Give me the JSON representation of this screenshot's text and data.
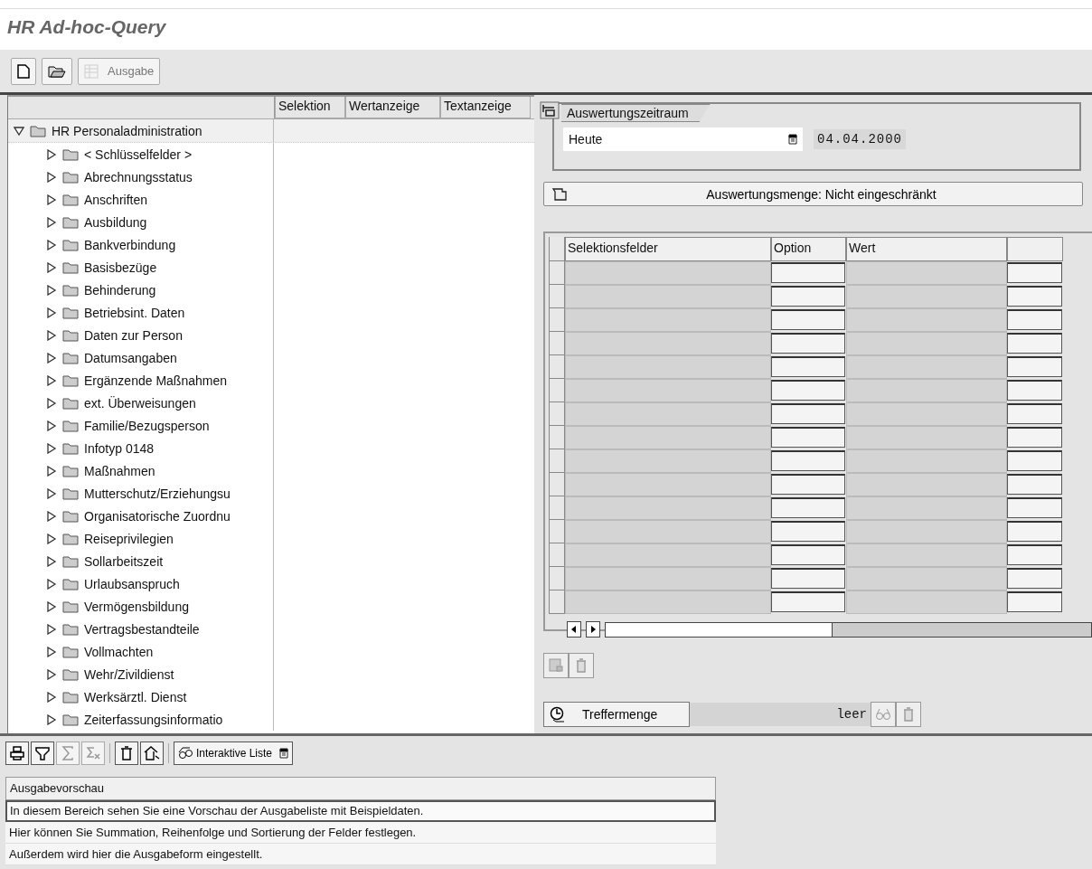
{
  "window": {
    "title": "HR Ad-hoc-Query"
  },
  "toolbar": [
    {
      "kind": "new",
      "disabled": false
    },
    {
      "kind": "open",
      "disabled": false
    },
    {
      "kind": "output",
      "label": "Ausgabe",
      "disabled": true
    }
  ],
  "tree": {
    "columns": [
      "Selektion",
      "Wertanzeige",
      "Textanzeige"
    ],
    "root": {
      "label": "HR Personaladministration",
      "expanded": true,
      "children": [
        {
          "label": "< Schlüsselfelder >",
          "expanded": false
        },
        {
          "label": "Abrechnungsstatus",
          "expanded": false
        },
        {
          "label": "Anschriften",
          "expanded": false
        },
        {
          "label": "Ausbildung",
          "expanded": false
        },
        {
          "label": "Bankverbindung",
          "expanded": false
        },
        {
          "label": "Basisbezüge",
          "expanded": false
        },
        {
          "label": "Behinderung",
          "expanded": false
        },
        {
          "label": "Betriebsint. Daten",
          "expanded": false
        },
        {
          "label": "Daten zur Person",
          "expanded": false
        },
        {
          "label": "Datumsangaben",
          "expanded": false
        },
        {
          "label": "Ergänzende Maßnahmen",
          "expanded": false
        },
        {
          "label": "ext. Überweisungen",
          "expanded": false
        },
        {
          "label": "Familie/Bezugsperson",
          "expanded": false
        },
        {
          "label": "Infotyp 0148",
          "expanded": false
        },
        {
          "label": "Maßnahmen",
          "expanded": false
        },
        {
          "label": "Mutterschutz/Erziehungsu",
          "expanded": false
        },
        {
          "label": "Organisatorische Zuordnu",
          "expanded": false
        },
        {
          "label": "Reiseprivilegien",
          "expanded": false
        },
        {
          "label": "Sollarbeitszeit",
          "expanded": false
        },
        {
          "label": "Urlaubsanspruch",
          "expanded": false
        },
        {
          "label": "Vermögensbildung",
          "expanded": false
        },
        {
          "label": "Vertragsbestandteile",
          "expanded": false
        },
        {
          "label": "Vollmachten",
          "expanded": false
        },
        {
          "label": "Wehr/Zivildienst",
          "expanded": false
        },
        {
          "label": "Werksärztl. Dienst",
          "expanded": false
        },
        {
          "label": "Zeiterfassungsinformatio",
          "expanded": false
        }
      ]
    }
  },
  "period": {
    "tab": "Auswertungszeitraum",
    "value": "Heute",
    "date": "04.04.2000"
  },
  "set_button": "Auswertungsmenge: Nicht eingeschränkt",
  "selection_table": {
    "columns": [
      "Selektionsfelder",
      "Option",
      "Wert"
    ]
  },
  "hits": {
    "button": "Treffermenge",
    "status": "leer"
  },
  "output_toolbar": [
    {
      "kind": "print",
      "disabled": false
    },
    {
      "kind": "filter",
      "disabled": false
    },
    {
      "kind": "sum",
      "disabled": true
    },
    {
      "kind": "subtotal",
      "disabled": true
    },
    {
      "kind": "delete",
      "disabled": false
    },
    {
      "kind": "layout",
      "disabled": false
    },
    {
      "kind": "list",
      "label": "Interaktive Liste",
      "disabled": false
    }
  ],
  "preview": {
    "title": "Ausgabevorschau",
    "rows": [
      {
        "text": "In diesem Bereich sehen Sie eine Vorschau der Ausgabeliste mit Beispieldaten.",
        "selected": true
      },
      {
        "text": "Hier können Sie Summation, Reihenfolge und Sortierung der Felder festlegen.",
        "selected": false
      },
      {
        "text": "Außerdem wird hier die Ausgabeform eingestellt.",
        "selected": false
      }
    ]
  }
}
